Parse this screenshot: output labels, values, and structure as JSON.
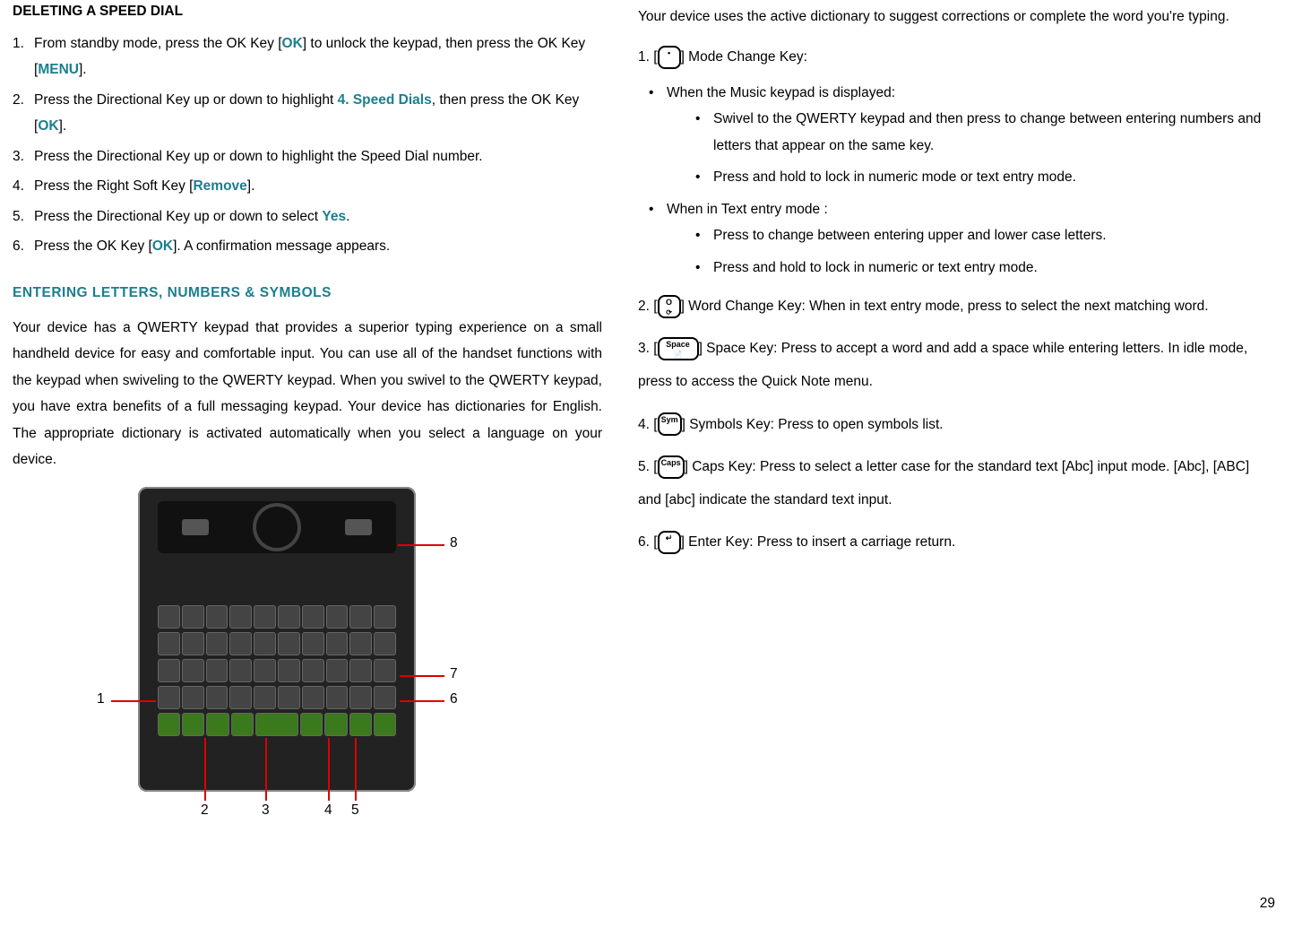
{
  "left": {
    "h_del": "DELETING A SPEED DIAL",
    "steps": [
      {
        "pre": "From standby mode, press the OK Key [",
        "ok": "OK",
        "post": "] to unlock the keypad, then press the OK Key [",
        "menu": "MENU",
        "post2": "]."
      },
      {
        "pre": "Press the Directional Key up or down to highlight ",
        "sd": "4. Speed Dials",
        "post": ", then press the OK Key [",
        "ok": "OK",
        "post2": "]."
      },
      {
        "t": "Press the Directional Key up or down to highlight the Speed Dial number."
      },
      {
        "pre": "Press the Right Soft Key [",
        "rm": "Remove",
        "post": "]."
      },
      {
        "pre": "Press the Directional Key up or down to select ",
        "yes": "Yes",
        "post": "."
      },
      {
        "pre": "Press the OK Key [",
        "ok": "OK",
        "post": "]. A confirmation message appears."
      }
    ],
    "h_ent": "ENTERING LETTERS, NUMBERS & SYMBOLS",
    "p_ent": "Your device has a QWERTY keypad that provides a superior typing experience on a small handheld device for easy and comfortable input. You can use all of the handset functions with the keypad when swiveling to the QWERTY keypad. When you swivel to the QWERTY keypad, you have extra benefits of a full messaging keypad. Your device has dictionaries for English. The appropriate dictionary is activated automatically when you select a language on your device.",
    "callouts": {
      "c1": "1",
      "c2": "2",
      "c3": "3",
      "c4": "4",
      "c5": "5",
      "c6": "6",
      "c7": "7",
      "c8": "8"
    }
  },
  "right": {
    "intro": "Your device uses the active dictionary to suggest corrections or complete the word you're typing.",
    "items": [
      {
        "num": "1.",
        "icon": {
          "label": "•"
        },
        "label": "] Mode Change Key:",
        "sub": [
          {
            "t": "When the Music keypad is displayed:",
            "sub": [
              {
                "t": "Swivel to the QWERTY keypad and then press to change between entering numbers and letters that appear on the same key."
              },
              {
                "t": "Press and hold to lock in numeric mode or text entry mode."
              }
            ]
          },
          {
            "t": "When in Text entry mode :",
            "sub": [
              {
                "t": "Press to change between entering upper and lower case letters."
              },
              {
                "t": "Press and hold to lock in numeric or text entry mode."
              }
            ]
          }
        ]
      },
      {
        "num": "2.",
        "icon": {
          "label": "O",
          "sub": "⟳"
        },
        "label": "] Word Change Key: When in text entry mode, press to select the next matching word."
      },
      {
        "num": "3.",
        "icon": {
          "label": "Space",
          "sub": "📄",
          "cls": "space"
        },
        "label": "] Space Key: Press to accept a word and add a space while entering letters. In idle mode, press to access the Quick Note menu."
      },
      {
        "num": "4.",
        "icon": {
          "label": "Sym"
        },
        "label": "] Symbols Key: Press to open symbols list."
      },
      {
        "num": "5.",
        "icon": {
          "label": "Caps"
        },
        "label": "] Caps Key: Press to select a letter case for the standard text [Abc] input mode. [Abc], [ABC] and [abc] indicate the standard text input."
      },
      {
        "num": "6.",
        "icon": {
          "label": "↵"
        },
        "label": "] Enter Key: Press to insert a carriage return."
      }
    ]
  },
  "pagenum": "29"
}
